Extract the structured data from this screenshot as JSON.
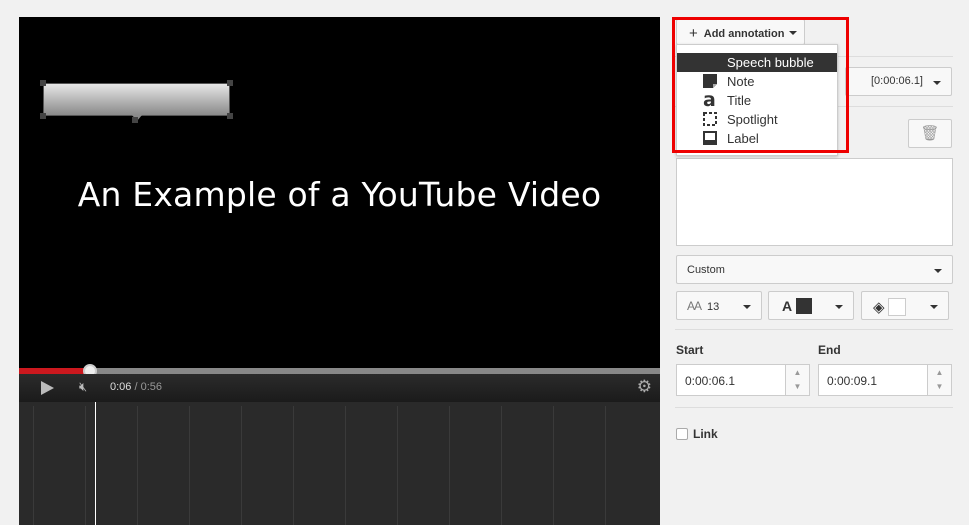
{
  "video": {
    "title_text": "An Example of a YouTube Video",
    "current_time": "0:06",
    "duration": "0:56",
    "progress": 0.11
  },
  "toolbar": {
    "add_annotation_label": "Add annotation"
  },
  "annotation_menu": {
    "items": [
      {
        "label": "Speech bubble",
        "icon": "speech-bubble-icon",
        "selected": true
      },
      {
        "label": "Note",
        "icon": "note-icon",
        "selected": false
      },
      {
        "label": "Title",
        "icon": "title-icon",
        "selected": false
      },
      {
        "label": "Spotlight",
        "icon": "spotlight-icon",
        "selected": false
      },
      {
        "label": "Label",
        "icon": "label-icon",
        "selected": false
      }
    ]
  },
  "editor": {
    "time_select_value": "[0:00:06.1]",
    "style_select_value": "Custom",
    "font_size_value": "13",
    "text_color": "#333333",
    "background_color": "#ffffff",
    "start_label": "Start",
    "start_value": "0:00:06.1",
    "end_label": "End",
    "end_value": "0:00:09.1",
    "link_label": "Link"
  },
  "colors": {
    "highlight": "#ee0000",
    "progress_red": "#cc181e"
  }
}
